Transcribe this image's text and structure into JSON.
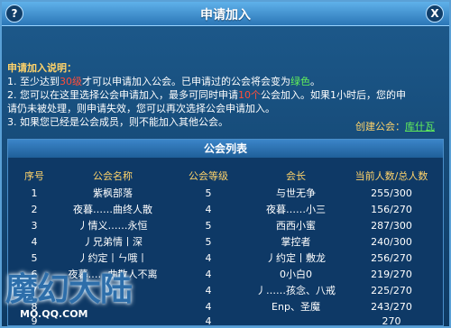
{
  "window": {
    "title": "申请加入",
    "help": "?",
    "close": "X"
  },
  "info": {
    "heading": "申请加入说明：",
    "line1_pre": "1. 至少达到",
    "line1_level": "30级",
    "line1_mid": "才可以申请加入公会。已申请过的公会将会变为",
    "line1_color": "绿色",
    "line1_end": "。",
    "line2_pre": "2. 您可以在这里选择公会申请加入，最多可同时申请",
    "line2_count": "10个",
    "line2_end": "公会加入。如果1小时后，您的申",
    "line3": "请仍未被处理，则申请失效，您可以再次选择公会申请加入。",
    "line4": "3. 如果您已经是公会成员，则不能加入其他公会。",
    "creator_label": "创建公会：",
    "creator_name": "库什瓦"
  },
  "list": {
    "title": "公会列表",
    "columns": [
      "序号",
      "公会名称",
      "公会等级",
      "会长",
      "当前人数/总人数"
    ],
    "rows": [
      [
        "1",
        "紫枫部落",
        "5",
        "与世无争",
        "255/300"
      ],
      [
        "2",
        "夜暮……曲终人散",
        "4",
        "夜暮……小三",
        "156/270"
      ],
      [
        "3",
        "丿情义……永恒",
        "5",
        "西西小蜜",
        "287/300"
      ],
      [
        "4",
        "丿兄弟情丨深",
        "5",
        "掌控者",
        "240/300"
      ],
      [
        "5",
        "丿约定丨ㄣ哦丨",
        "4",
        "丿约定丨敷龙",
        "256/270"
      ],
      [
        "6",
        "夜暮……曲散人不离",
        "4",
        "0小白0",
        "219/270"
      ],
      [
        "7",
        "",
        "4",
        "丿……孩念、八戒",
        "225/270"
      ],
      [
        "8",
        "",
        "4",
        "Enp、圣魔",
        "243/270"
      ],
      [
        "9",
        "",
        "4",
        "",
        "270"
      ]
    ]
  },
  "watermark": {
    "text": "魔幻大陆",
    "sub": "MO.QQ.COM"
  },
  "colors": {
    "accent": "#5fb1ea",
    "highlight_red": "#ff4e3a",
    "highlight_green": "#62f05a",
    "gold": "#ffd36a"
  }
}
